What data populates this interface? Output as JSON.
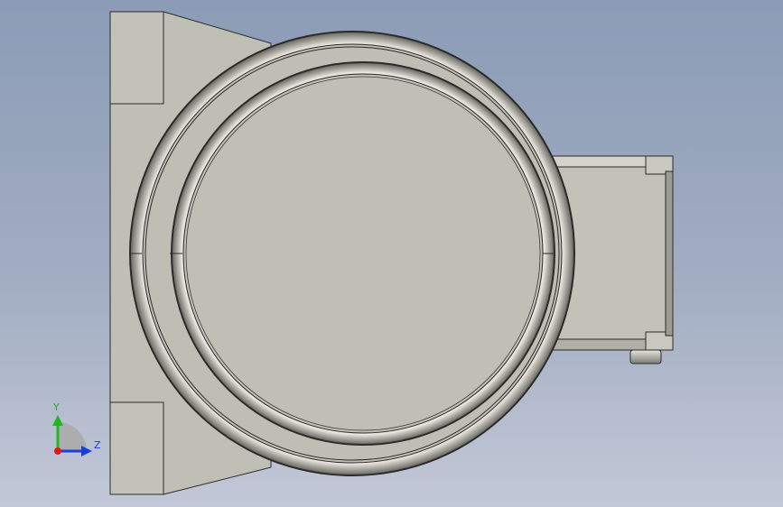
{
  "viewport": {
    "background_top": "#8b9cb6",
    "background_bottom": "#c2c8d7"
  },
  "model": {
    "body_color": "#c0bfb5",
    "edge_color": "#2b2b2b",
    "highlight_color": "#f2f2ee"
  },
  "triad": {
    "x_axis_label": "",
    "y_axis_label": "Y",
    "z_axis_label": "Z",
    "y_color": "#1fb81f",
    "z_color": "#1a3fd8",
    "x_color": "#e01818",
    "icon": "coordinate-triad-icon"
  }
}
